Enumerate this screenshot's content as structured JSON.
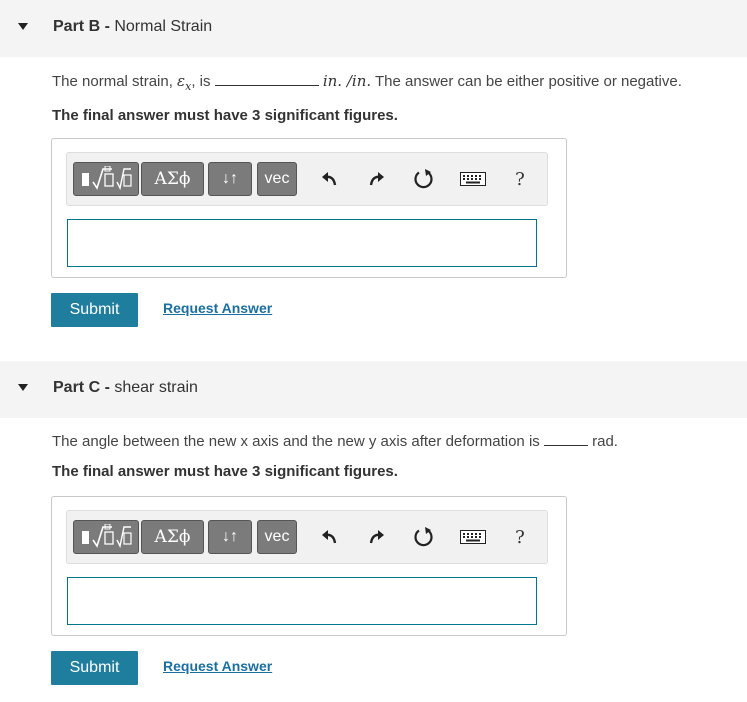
{
  "partB": {
    "title_bold": "Part B",
    "title_sep": " - ",
    "title_text": "Normal Strain",
    "prompt_before": "The normal strain, ",
    "prompt_symbol": "ε",
    "prompt_subscript": "x",
    "prompt_mid": ", is",
    "prompt_units": "in. /in.",
    "prompt_after": " The answer can be either positive or negative.",
    "sigfig_note": "The final answer must have 3 significant figures.",
    "answer_value": "",
    "submit_label": "Submit",
    "request_label": "Request Answer"
  },
  "partC": {
    "title_bold": "Part C",
    "title_sep": " - ",
    "title_text": "shear strain",
    "prompt_before": "The angle between the new x axis and the new y axis after deformation is",
    "prompt_after": "rad.",
    "sigfig_note": "The final answer must have 3 significant figures.",
    "answer_value": "",
    "submit_label": "Submit",
    "request_label": "Request Answer"
  },
  "toolbar": {
    "greek_label": "ΑΣϕ",
    "arrows_label": "↓↑",
    "vec_label": "vec",
    "help_label": "?"
  },
  "colors": {
    "accent": "#1f7d9d",
    "link": "#1a6fa0",
    "input_border": "#00768e",
    "header_bg": "#f4f4f4"
  },
  "icons": [
    "templates-icon",
    "undo-icon",
    "redo-icon",
    "reset-icon",
    "keyboard-icon",
    "help-icon"
  ]
}
